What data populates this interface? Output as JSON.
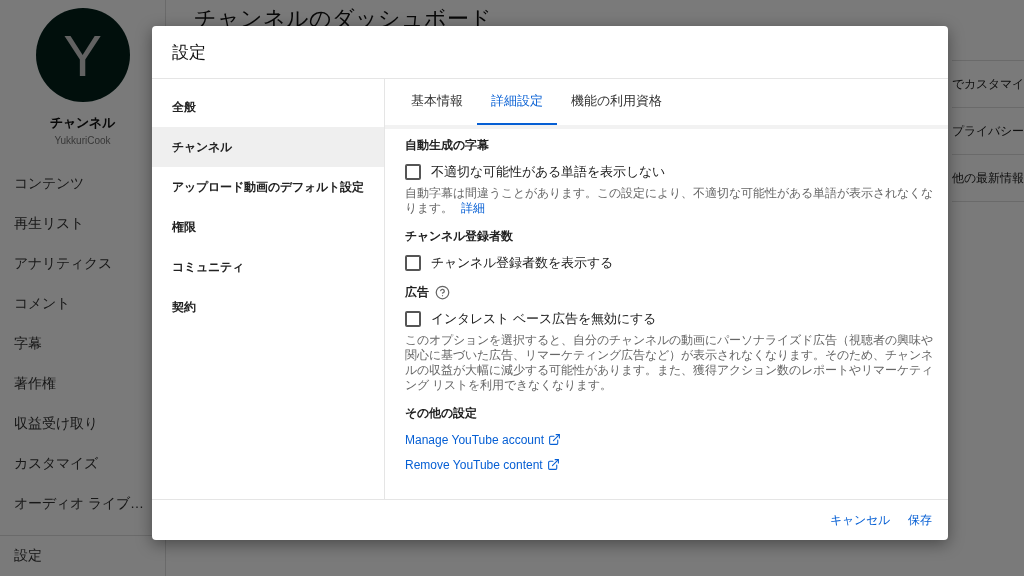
{
  "background": {
    "avatar_letter": "Y",
    "channel_label": "チャンネル",
    "handle": "YukkuriCook",
    "nav": [
      {
        "label": "コンテンツ"
      },
      {
        "label": "再生リスト"
      },
      {
        "label": "アナリティクス"
      },
      {
        "label": "コメント"
      },
      {
        "label": "字幕"
      },
      {
        "label": "著作権"
      },
      {
        "label": "収益受け取り"
      },
      {
        "label": "カスタマイズ"
      },
      {
        "label": "オーディオ ライブ…"
      }
    ],
    "settings_label": "設定",
    "page_title": "チャンネルのダッシュボード",
    "card_lines": [
      "でカスタマイ",
      "プライバシー",
      "他の最新情報"
    ]
  },
  "dialog": {
    "title": "設定",
    "nav": [
      {
        "label": "全般",
        "selected": false
      },
      {
        "label": "チャンネル",
        "selected": true
      },
      {
        "label": "アップロード動画のデフォルト設定",
        "selected": false
      },
      {
        "label": "権限",
        "selected": false
      },
      {
        "label": "コミュニティ",
        "selected": false
      },
      {
        "label": "契約",
        "selected": false
      }
    ],
    "tabs": [
      {
        "label": "基本情報",
        "selected": false
      },
      {
        "label": "詳細設定",
        "selected": true
      },
      {
        "label": "機能の利用資格",
        "selected": false
      }
    ],
    "sections": [
      {
        "heading": "自動生成の字幕",
        "help": false,
        "option": {
          "label": "不適切な可能性がある単語を表示しない",
          "checked": false
        },
        "note": "自動字幕は間違うことがあります。この設定により、不適切な可能性がある単語が表示されなくなります。",
        "note_link": "詳細"
      },
      {
        "heading": "チャンネル登録者数",
        "help": false,
        "option": {
          "label": "チャンネル登録者数を表示する",
          "checked": false
        }
      },
      {
        "heading": "広告",
        "help": true,
        "option": {
          "label": "インタレスト ベース広告を無効にする",
          "checked": false
        },
        "note": "このオプションを選択すると、自分のチャンネルの動画にパーソナライズド広告（視聴者の興味や関心に基づいた広告、リマーケティング広告など）が表示されなくなります。そのため、チャンネルの収益が大幅に減少する可能性があります。また、獲得アクション数のレポートやリマーケティング リストを利用できなくなります。"
      },
      {
        "heading": "その他の設定",
        "help": false,
        "links": [
          "Manage YouTube account",
          "Remove YouTube content"
        ]
      }
    ],
    "buttons": [
      "キャンセル",
      "保存"
    ]
  }
}
